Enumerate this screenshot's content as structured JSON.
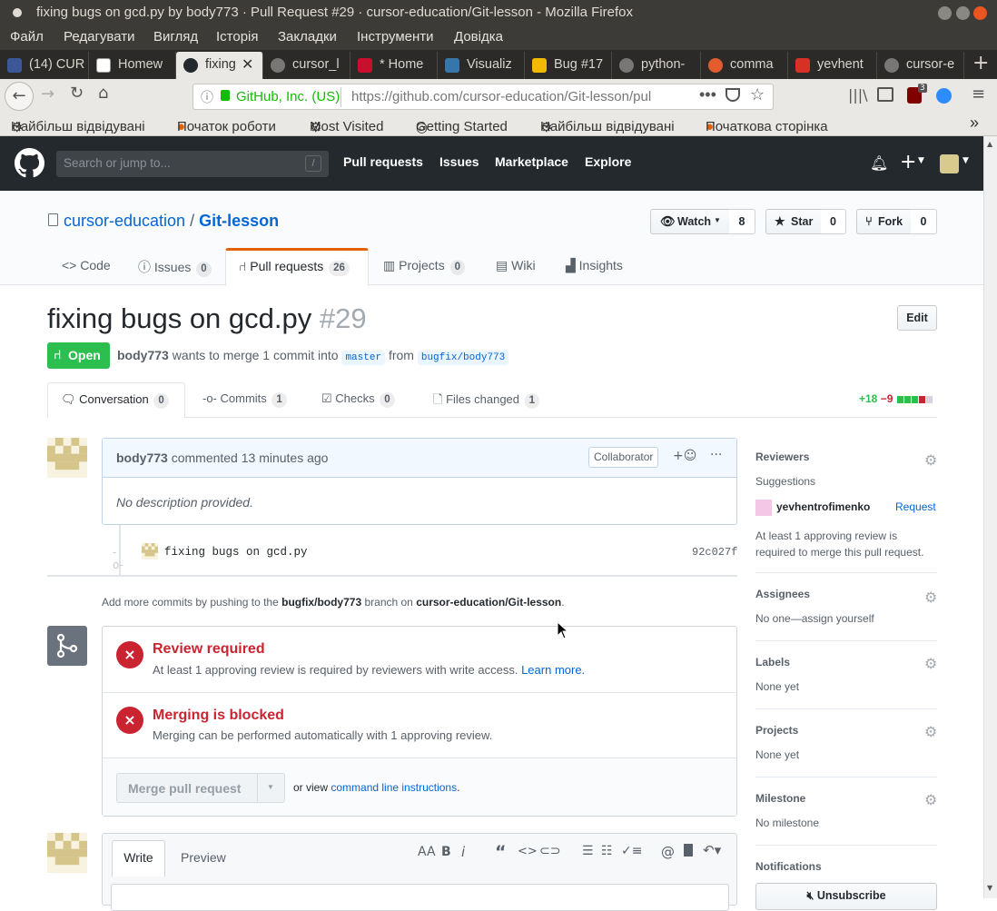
{
  "window": {
    "title": "fixing bugs on gcd.py by body773 · Pull Request #29 · cursor-education/Git-lesson - Mozilla Firefox"
  },
  "menu": [
    "Файл",
    "Редагувати",
    "Вигляд",
    "Історія",
    "Закладки",
    "Інструменти",
    "Довідка"
  ],
  "tabs": [
    {
      "label": "(14) CUR",
      "color": "#3b5998",
      "glyph": "f"
    },
    {
      "label": "Homew",
      "color": "#ffffff",
      "glyph": "T"
    },
    {
      "label": "fixing",
      "color": "#24292e",
      "glyph": "●"
    },
    {
      "label": "cursor_l",
      "color": "#24292e",
      "glyph": "●"
    },
    {
      "label": "* Home",
      "color": "#c8102e",
      "glyph": "■"
    },
    {
      "label": "Visualiz",
      "color": "#3776ab",
      "glyph": "◆"
    },
    {
      "label": "Bug #17",
      "color": "#f5b800",
      "glyph": "lp"
    },
    {
      "label": "python-",
      "color": "#24292e",
      "glyph": "●"
    },
    {
      "label": "comma",
      "color": "#e45c2d",
      "glyph": "ask"
    },
    {
      "label": "yevhent",
      "color": "#d93025",
      "glyph": "M"
    },
    {
      "label": "cursor-e",
      "color": "#24292e",
      "glyph": "●"
    }
  ],
  "urlbar": {
    "identity": "GitHub, Inc. (US)",
    "url": "https://github.com/cursor-education/Git-lesson/pul",
    "badge": "3"
  },
  "bookmarks": [
    "Найбільш відвідувані",
    "Початок роботи",
    "Most Visited",
    "Getting Started",
    "Найбільш відвідувані",
    "Початкова сторінка"
  ],
  "gh": {
    "search_placeholder": "Search or jump to...",
    "search_key": "/",
    "nav": [
      "Pull requests",
      "Issues",
      "Marketplace",
      "Explore"
    ]
  },
  "repo": {
    "owner": "cursor-education",
    "sep": "/",
    "name": "Git-lesson",
    "watch": "Watch",
    "watch_count": "8",
    "star": "Star",
    "star_count": "0",
    "fork": "Fork",
    "fork_count": "0",
    "tabs": [
      {
        "label": "Code",
        "count": ""
      },
      {
        "label": "Issues",
        "count": "0"
      },
      {
        "label": "Pull requests",
        "count": "26"
      },
      {
        "label": "Projects",
        "count": "0"
      },
      {
        "label": "Wiki",
        "count": ""
      },
      {
        "label": "Insights",
        "count": ""
      }
    ]
  },
  "pr": {
    "title": "fixing bugs on gcd.py",
    "number": "#29",
    "edit": "Edit",
    "state": "Open",
    "author": "body773",
    "merge_text": "wants to merge 1 commit into",
    "base": "master",
    "from": "from",
    "head": "bugfix/body773",
    "tabs": [
      {
        "label": "Conversation",
        "count": "0"
      },
      {
        "label": "Commits",
        "count": "1"
      },
      {
        "label": "Checks",
        "count": "0"
      },
      {
        "label": "Files changed",
        "count": "1"
      }
    ],
    "additions": "+18",
    "deletions": "−9"
  },
  "comment": {
    "author": "body773",
    "time": "commented 13 minutes ago",
    "badge": "Collaborator",
    "body": "No description provided."
  },
  "commit": {
    "message": "fixing bugs on gcd.py",
    "sha": "92c027f"
  },
  "push_hint": {
    "pre": "Add more commits by pushing to the",
    "branch": "bugfix/body773",
    "mid": "branch on",
    "repo": "cursor-education/Git-lesson",
    "end": "."
  },
  "merge": {
    "review_title": "Review required",
    "review_text": "At least 1 approving review is required by reviewers with write access.",
    "learn": "Learn more.",
    "blocked_title": "Merging is blocked",
    "blocked_text": "Merging can be performed automatically with 1 approving review.",
    "button": "Merge pull request",
    "or_view": "or view",
    "cli": "command line instructions",
    "cli_end": "."
  },
  "composer": {
    "write": "Write",
    "preview": "Preview"
  },
  "sidebar": {
    "reviewers": "Reviewers",
    "suggestions": "Suggestions",
    "suggested_user": "yevhentrofimenko",
    "request": "Request",
    "review_note": "At least 1 approving review is required to merge this pull request.",
    "assignees": "Assignees",
    "assignees_val": "No one—assign yourself",
    "labels": "Labels",
    "labels_val": "None yet",
    "projects": "Projects",
    "projects_val": "None yet",
    "milestone": "Milestone",
    "milestone_val": "No milestone",
    "notifications": "Notifications",
    "unsubscribe": "Unsubscribe"
  },
  "colors": {
    "green": "#2cbe4e",
    "red": "#cb2431",
    "link": "#0366d6",
    "header": "#24292e"
  }
}
